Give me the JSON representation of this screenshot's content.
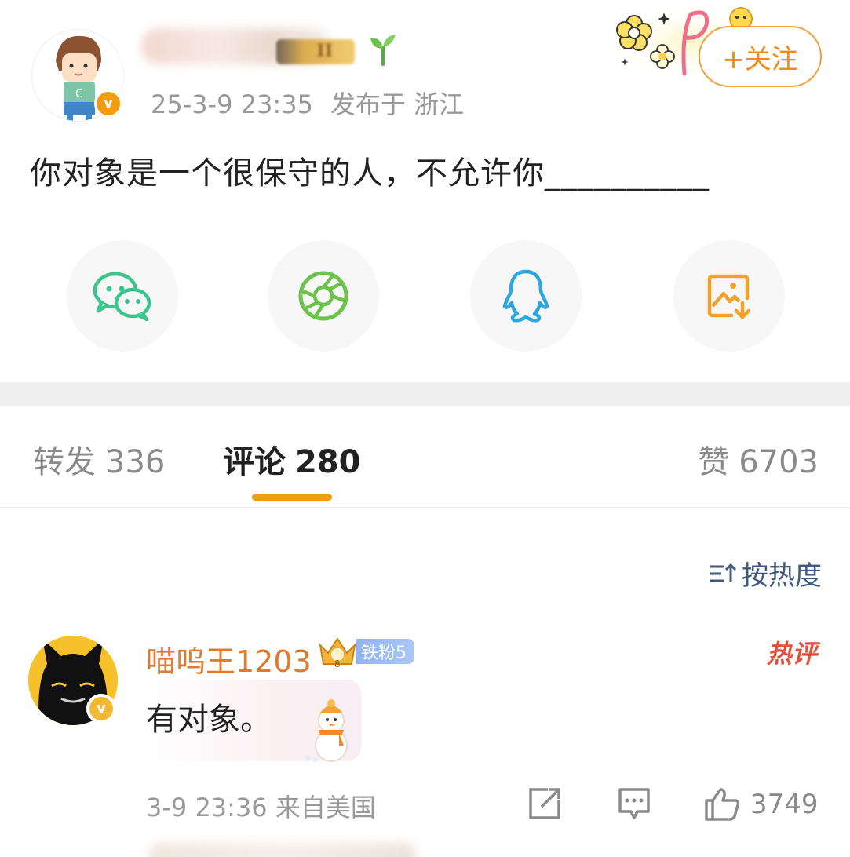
{
  "post": {
    "author_name": "",
    "timestamp": "25-3-9 23:35",
    "location": "发布于 浙江",
    "follow_label": "+关注",
    "text": "你对象是一个很保守的人，不允许你__________",
    "level_badge": "II"
  },
  "share": {
    "items": [
      "wechat-icon",
      "moments-icon",
      "qq-icon",
      "save-image-icon"
    ]
  },
  "tabs": {
    "repost_label": "转发",
    "repost_count": "336",
    "comment_label": "评论",
    "comment_count": "280",
    "like_label": "赞",
    "like_count": "6703"
  },
  "sort": {
    "label": "按热度"
  },
  "comment": {
    "username": "喵呜王1203",
    "fan_badge": "铁粉5",
    "crown_level": "8",
    "hot_label": "热评",
    "text": "有对象。",
    "time": "3-9 23:36",
    "source": "来自美国",
    "like_count": "3749"
  },
  "colors": {
    "accent": "#f39c12",
    "follow": "#f08a1c",
    "username": "#e07a2c",
    "sort": "#3e5a7c",
    "hot": "#e0533a",
    "wechat": "#3bc58c",
    "moments": "#6cc24a",
    "qq": "#2ea7e0",
    "save": "#f2a12b"
  }
}
